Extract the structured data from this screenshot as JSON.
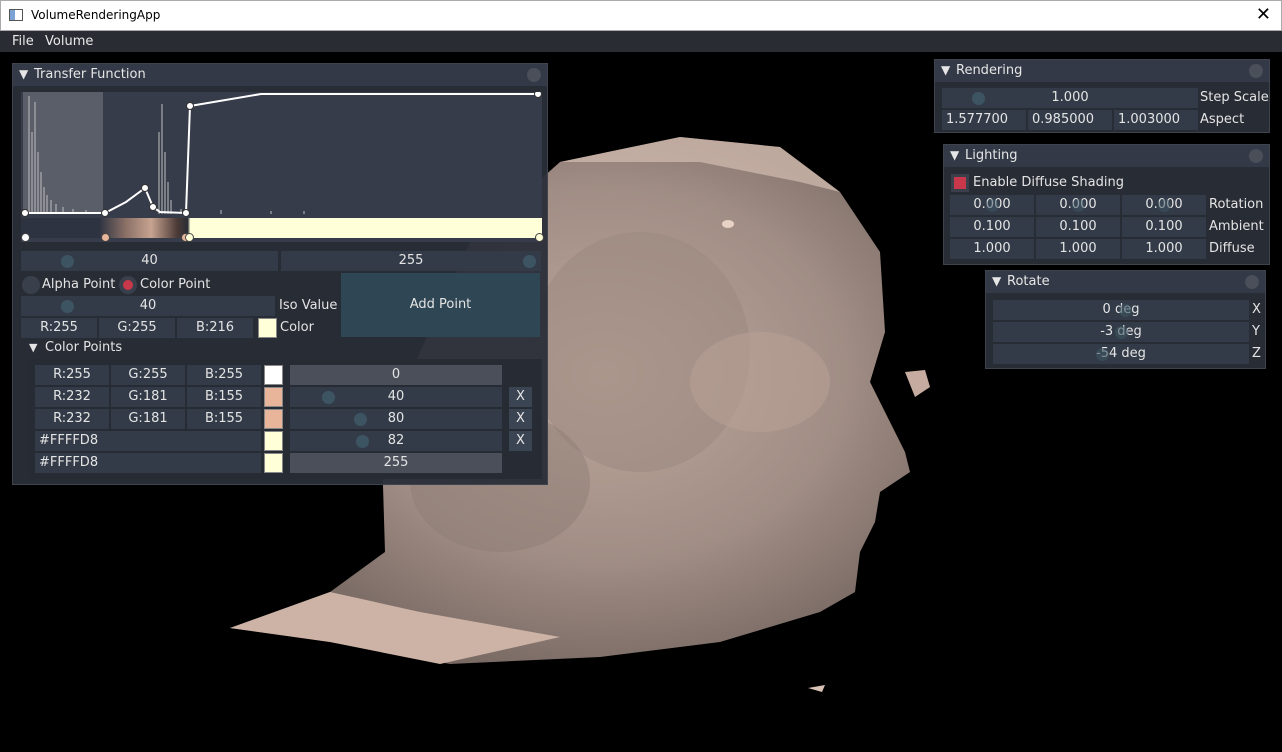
{
  "window": {
    "title": "VolumeRenderingApp",
    "close_glyph": "✕"
  },
  "menu": {
    "items": [
      "File",
      "Volume"
    ]
  },
  "transfer_function": {
    "title": "Transfer Function",
    "range_min": "40",
    "range_max": "255",
    "alpha_point_label": "Alpha Point",
    "color_point_label": "Color Point",
    "iso_value": "40",
    "iso_value_label": "Iso Value",
    "add_point_label": "Add Point",
    "r": "R:255",
    "g": "G:255",
    "b": "B:216",
    "color_label": "Color",
    "current_color": "#FFFFD8",
    "accent_color": "#c8384a",
    "color_points_title": "Color Points",
    "color_points": [
      {
        "r": "R:255",
        "g": "G:255",
        "b": "B:255",
        "swatch": "#FFFFFF",
        "value": "0",
        "removable": false
      },
      {
        "r": "R:232",
        "g": "G:181",
        "b": "B:155",
        "swatch": "#E8B59B",
        "value": "40",
        "removable": true,
        "delete": "X"
      },
      {
        "r": "R:232",
        "g": "G:181",
        "b": "B:155",
        "swatch": "#E8B59B",
        "value": "80",
        "removable": true,
        "delete": "X"
      },
      {
        "hex": "#FFFFD8",
        "swatch": "#FFFFD8",
        "value": "82",
        "removable": true,
        "delete": "X"
      },
      {
        "hex": "#FFFFD8",
        "swatch": "#FFFFD8",
        "value": "255",
        "removable": false
      }
    ]
  },
  "rendering": {
    "title": "Rendering",
    "step_scale": "1.000",
    "step_scale_label": "Step Scale",
    "aspect": [
      "1.577700",
      "0.985000",
      "1.003000"
    ],
    "aspect_label": "Aspect"
  },
  "lighting": {
    "title": "Lighting",
    "diffuse_shading_label": "Enable Diffuse Shading",
    "rotation": [
      "0.000",
      "0.000",
      "0.000"
    ],
    "rotation_label": "Rotation",
    "ambient": [
      "0.100",
      "0.100",
      "0.100"
    ],
    "ambient_label": "Ambient",
    "diffuse": [
      "1.000",
      "1.000",
      "1.000"
    ],
    "diffuse_label": "Diffuse"
  },
  "rotate": {
    "title": "Rotate",
    "x": "0 deg",
    "x_label": "X",
    "y": "-3 deg",
    "y_label": "Y",
    "z": "-54 deg",
    "z_label": "Z"
  },
  "icons": {
    "collapse": "triangle-down-icon",
    "panel_close": "circle-close-icon"
  }
}
